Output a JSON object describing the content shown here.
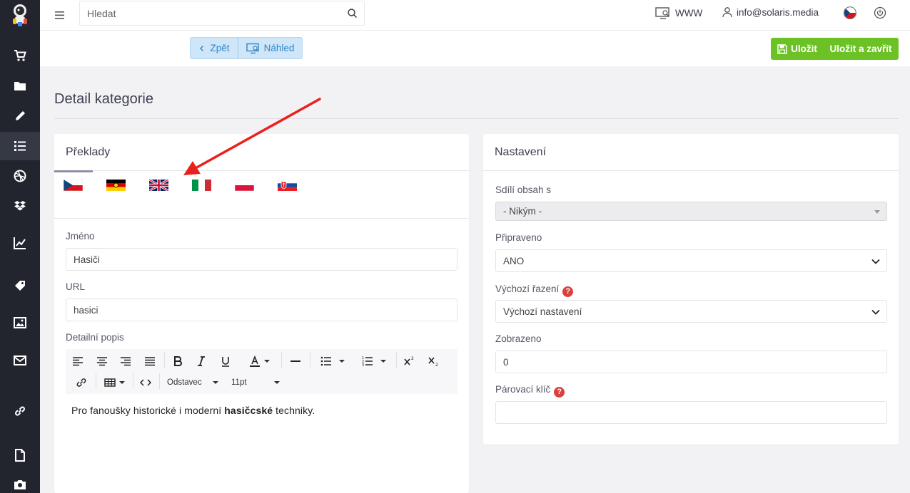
{
  "sidebar": {
    "items": [
      {
        "icon": "cart-icon"
      },
      {
        "icon": "folder-icon"
      },
      {
        "icon": "pencil-icon"
      },
      {
        "icon": "list-icon",
        "active": true
      },
      {
        "icon": "dribbble-icon"
      },
      {
        "icon": "dropbox-icon"
      },
      {
        "icon": "chart-icon"
      },
      {
        "icon": "tag-icon"
      },
      {
        "icon": "image-icon"
      },
      {
        "icon": "mail-icon"
      },
      {
        "icon": "link-icon"
      },
      {
        "icon": "file-icon"
      },
      {
        "icon": "camera-icon"
      }
    ]
  },
  "topbar": {
    "search_placeholder": "Hledat",
    "www_label": "WWW",
    "user_email": "info@solaris.media"
  },
  "actions": {
    "back_label": "Zpět",
    "preview_label": "Náhled",
    "save_label": "Uložit",
    "save_close_label": "Uložit a zavřít"
  },
  "page": {
    "title": "Detail kategorie"
  },
  "translations": {
    "title": "Překlady",
    "flags": [
      "cz",
      "de",
      "gb",
      "it",
      "pl",
      "sk"
    ],
    "name_label": "Jméno",
    "name_value": "Hasiči",
    "url_label": "URL",
    "url_value": "hasici",
    "desc_label": "Detailní popis",
    "editor": {
      "paragraph_select": "Odstavec",
      "font_size_select": "11pt",
      "text_before": "Pro fanoušky historické i moderní ",
      "text_bold": "hasičcské",
      "text_after": " techniky."
    }
  },
  "settings": {
    "title": "Nastavení",
    "shares_label": "Sdílí obsah s",
    "shares_value": "- Nikým -",
    "ready_label": "Připraveno",
    "ready_value": "ANO",
    "sort_label": "Výchozí řazení",
    "sort_value": "Výchozí nastavení",
    "shown_label": "Zobrazeno",
    "shown_value": "0",
    "pair_label": "Párovací klíč",
    "pair_value": ""
  },
  "colors": {
    "sidebar": "#22252e",
    "accent_green": "#6cc225",
    "accent_blue": "#2e86c8",
    "annotation_arrow": "#e8211e"
  }
}
